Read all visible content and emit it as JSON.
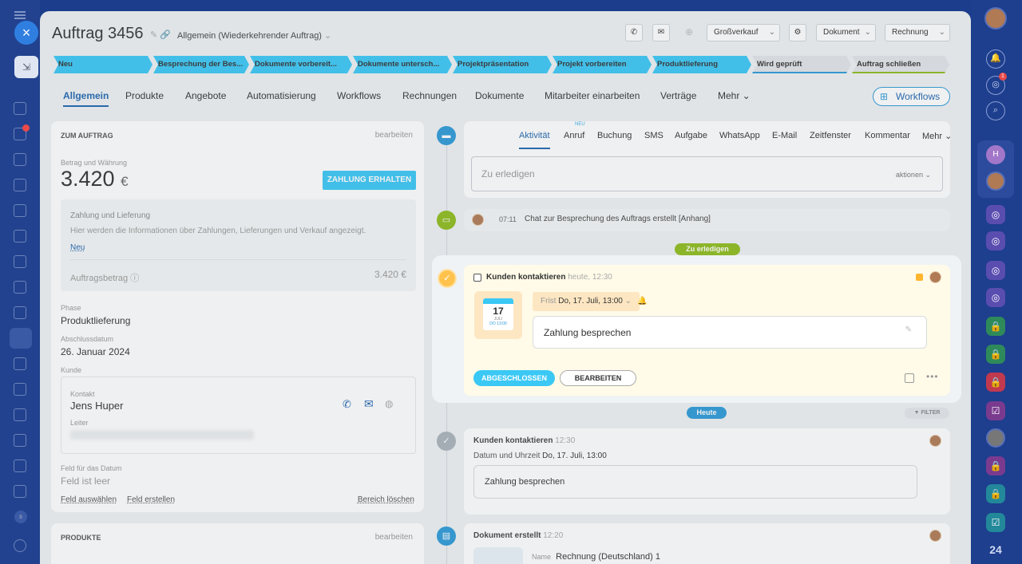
{
  "header": {
    "title": "Auftrag 3456",
    "category": "Allgemein (Wiederkehrender Auftrag)",
    "mode": "Großverkauf",
    "doc_btn": "Dokument",
    "invoice_btn": "Rechnung"
  },
  "stages": [
    {
      "label": "Neu",
      "color": "#3bc8f5"
    },
    {
      "label": "Besprechung der Bes...",
      "color": "#3bc8f5"
    },
    {
      "label": "Dokumente vorbereit...",
      "color": "#3bc8f5"
    },
    {
      "label": "Dokumente untersch...",
      "color": "#3bc8f5"
    },
    {
      "label": "Projektpräsentation",
      "color": "#3bc8f5"
    },
    {
      "label": "Projekt vorbereiten",
      "color": "#3bc8f5"
    },
    {
      "label": "Produktlieferung",
      "color": "#3bc8f5"
    },
    {
      "label": "Wird geprüft",
      "color": "#e2e4e7"
    },
    {
      "label": "Auftrag schließen",
      "color": "#e2e4e7"
    }
  ],
  "tabs": [
    "Allgemein",
    "Produkte",
    "Angebote",
    "Automatisierung",
    "Workflows",
    "Rechnungen",
    "Dokumente",
    "Mitarbeiter einarbeiten",
    "Verträge",
    "Mehr"
  ],
  "workflows_btn": "Workflows",
  "order": {
    "section": "ZUM AUFTRAG",
    "edit": "bearbeiten",
    "amount_label": "Betrag und Währung",
    "amount": "3.420",
    "currency": "€",
    "pay_btn": "ZAHLUNG ERHALTEN",
    "pay_title": "Zahlung und Lieferung",
    "pay_desc": "Hier werden die Informationen über Zahlungen, Lieferungen und Verkauf angezeigt.",
    "pay_new": "Neu",
    "total_label": "Auftragsbetrag",
    "total": "3.420 €",
    "phase_label": "Phase",
    "phase": "Produktlieferung",
    "close_label": "Abschlussdatum",
    "close_date": "26. Januar 2024",
    "client_label": "Kunde",
    "contact_label": "Kontakt",
    "contact_name": "Jens Huper",
    "lead_label": "Leiter",
    "date_field_label": "Feld für das Datum",
    "date_field_value": "Feld ist leer",
    "select_field": "Feld auswählen",
    "create_field": "Feld erstellen",
    "clear_area": "Bereich löschen"
  },
  "products": {
    "section": "PRODUKTE",
    "edit": "bearbeiten"
  },
  "activity": {
    "tabs": [
      "Aktivität",
      "Anruf",
      "Buchung",
      "SMS",
      "Aufgabe",
      "WhatsApp",
      "E-Mail",
      "Zeitfenster",
      "Kommentar",
      "Mehr"
    ],
    "new_badge": "NEU",
    "todo_placeholder": "Zu erledigen",
    "actions": "aktionen"
  },
  "timeline": {
    "chat_time": "07:11",
    "chat_text": "Chat zur Besprechung des Auftrags erstellt [Anhang]",
    "todo_pill": "Zu erledigen",
    "task_title": "Kunden kontaktieren",
    "task_time": "heute, 12:30",
    "cal_day": "17",
    "cal_month": "JULI",
    "cal_time": "DO 13:00",
    "deadline_label": "Frist",
    "deadline": "Do, 17. Juli, 13:00",
    "task_desc": "Zahlung besprechen",
    "done_btn": "ABGESCHLOSSEN",
    "edit_btn": "BEARBEITEN",
    "today_pill": "Heute",
    "filter": "FILTER",
    "past_title": "Kunden kontaktieren",
    "past_time": "12:30",
    "past_date_label": "Datum und Uhrzeit",
    "past_date": "Do, 17. Juli, 13:00",
    "past_desc": "Zahlung besprechen",
    "doc_title": "Dokument erstellt",
    "doc_time": "12:20",
    "doc_name_label": "Name",
    "doc_name": "Rechnung (Deutschland) 1"
  },
  "right_bar": {
    "logo": "24",
    "badge": "1",
    "user_initial": "H"
  },
  "colors": {
    "accent": "#3bc8f5",
    "link": "#2066b0",
    "green": "#8fbc1c"
  }
}
